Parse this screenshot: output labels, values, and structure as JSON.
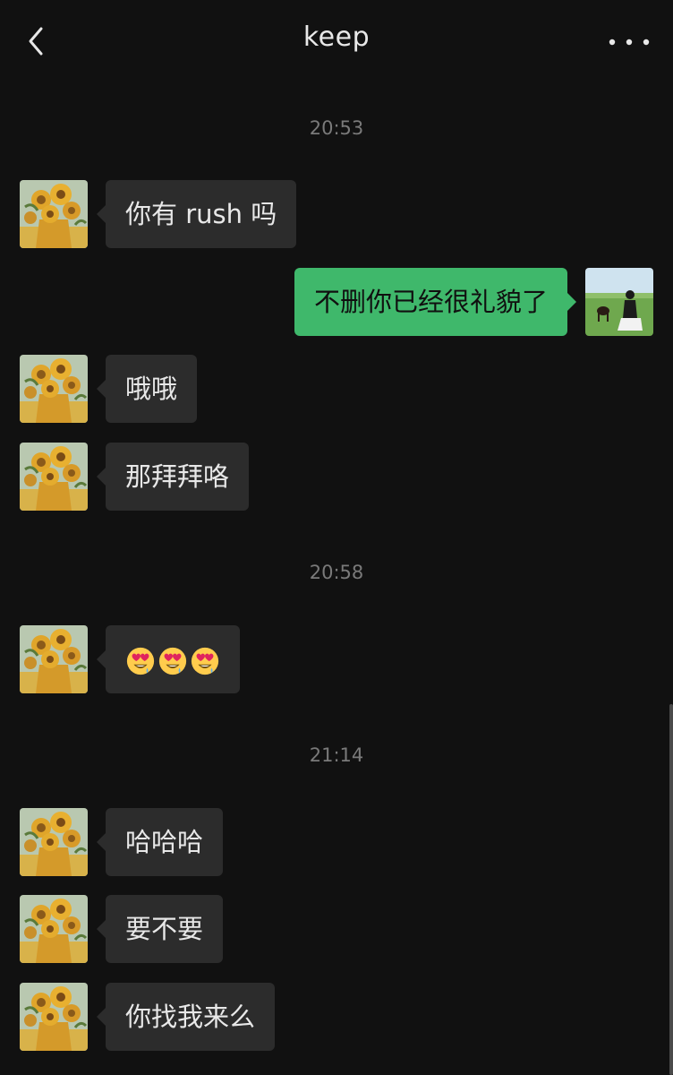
{
  "header": {
    "title": "keep",
    "back_icon": "chevron-left-icon",
    "more_icon": "more-horizontal-icon"
  },
  "timestamps": [
    "20:53",
    "20:58",
    "21:14"
  ],
  "messages": [
    {
      "side": "in",
      "text": "你有 rush 吗"
    },
    {
      "side": "out",
      "text": "不删你已经很礼貌了"
    },
    {
      "side": "in",
      "text": "哦哦"
    },
    {
      "side": "in",
      "text": "那拜拜咯"
    },
    {
      "side": "in",
      "emoji": [
        "smiling-face-with-heart-eyes",
        "smiling-face-with-heart-eyes",
        "smiling-face-with-heart-eyes"
      ]
    },
    {
      "side": "in",
      "text": "哈哈哈"
    },
    {
      "side": "in",
      "text": "要不要"
    },
    {
      "side": "in",
      "text": "你找我来么"
    }
  ],
  "colors": {
    "background": "#111111",
    "incoming_bubble": "#2c2c2c",
    "outgoing_bubble": "#3fb86b",
    "timestamp": "#7a7a7a"
  }
}
